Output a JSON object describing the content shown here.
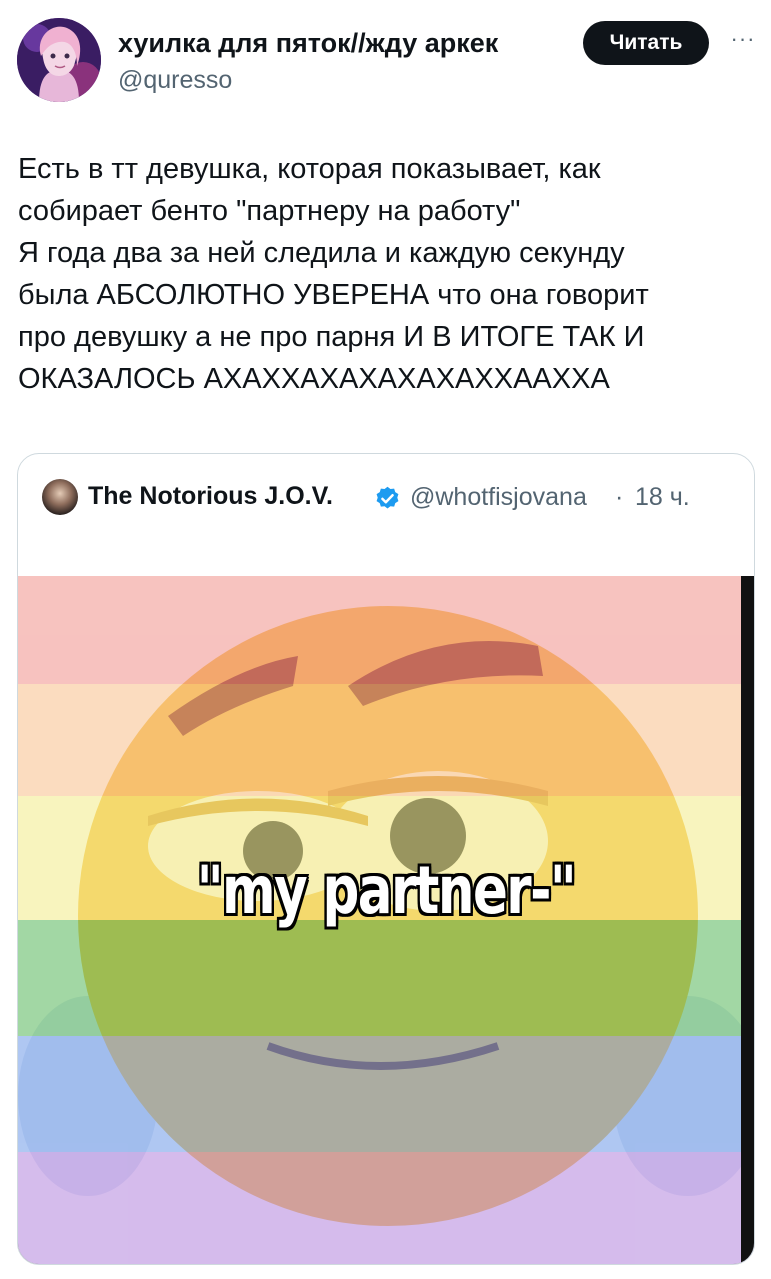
{
  "post": {
    "display_name": "хуилка для пяток//жду аркек",
    "handle": "@quresso",
    "follow_button_label": "Читать",
    "more_icon": "more-horizontal-icon",
    "more_glyph": "···",
    "text_lines": [
      "Есть в тт девушка, которая показывает, как",
      "собирает бенто \"партнеру на работу\"",
      "Я года два за ней следила и каждую секунду",
      "была АБСОЛЮТНО УВЕРЕНА что она говорит",
      "про девушку а не про парня И В ИТОГЕ ТАК И",
      "ОКАЗАЛОСЬ АХАХХАХАХАХАХАХХААХХА"
    ]
  },
  "quoted_post": {
    "display_name": "The Notorious J.O.V.",
    "verified": true,
    "handle": "@whotfisjovana",
    "separator": "·",
    "time": "18 ч.",
    "media": {
      "caption": "\"my partner-\"",
      "description_icon": "emoji-meme-image",
      "flag_colors": [
        "#f1928b",
        "#f8c08c",
        "#f3ec8a",
        "#8ed38f",
        "#8fb3ef",
        "#c09be0"
      ]
    }
  },
  "colors": {
    "text_primary": "#0f1419",
    "text_secondary": "#536471",
    "button_bg": "#0f1419",
    "verified_blue": "#1d9bf0",
    "border": "#cfd9de"
  }
}
